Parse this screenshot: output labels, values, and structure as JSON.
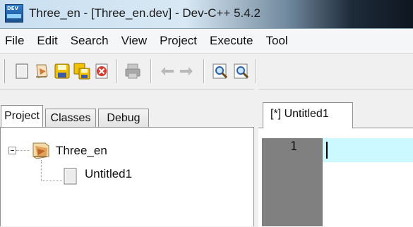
{
  "window": {
    "title": "Three_en - [Three_en.dev] - Dev-C++ 5.4.2",
    "icon_text": "DEV"
  },
  "menu": {
    "items": [
      "File",
      "Edit",
      "Search",
      "View",
      "Project",
      "Execute",
      "Tool"
    ]
  },
  "toolbar": {
    "icons": [
      "new-file-icon",
      "open-project-icon",
      "save-icon",
      "save-all-icon",
      "close-icon",
      "print-icon",
      "undo-icon",
      "redo-icon",
      "find-icon",
      "replace-icon"
    ]
  },
  "left_panel": {
    "tabs": [
      "Project",
      "Classes",
      "Debug"
    ],
    "active_tab": "Project",
    "tree": {
      "root": "Three_en",
      "children": [
        "Untitled1"
      ]
    }
  },
  "editor": {
    "tab_label": "[*] Untitled1",
    "line_numbers": [
      "1"
    ],
    "current_line_color": "#ccf8ff",
    "gutter_color": "#808080"
  }
}
